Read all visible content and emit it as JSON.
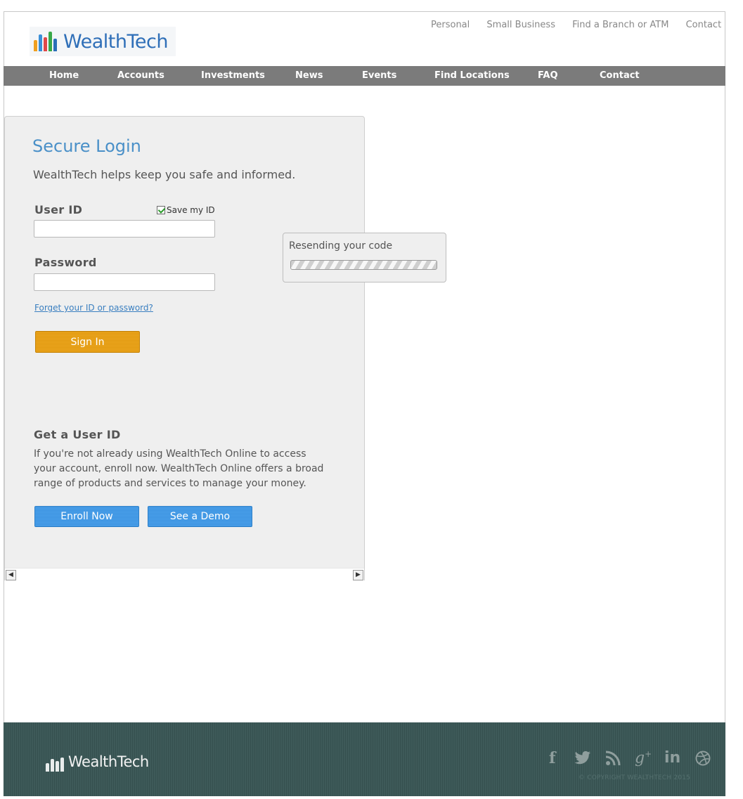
{
  "header": {
    "logo_text": "WealthTech",
    "top_links": [
      "Personal",
      "Small Business",
      "Find a Branch or ATM",
      "Contact Us"
    ]
  },
  "nav": {
    "items": [
      "Home",
      "Accounts",
      "Investments",
      "News",
      "Events",
      "Find Locations",
      "FAQ",
      "Contact"
    ]
  },
  "login": {
    "title": "Secure Login",
    "subtitle": "WealthTech helps keep you safe and informed.",
    "user_id_label": "User ID",
    "save_id_label": "Save my ID",
    "save_id_checked": true,
    "user_id_value": "",
    "password_label": "Password",
    "password_value": "",
    "forgot_link": "Forget your ID or password?",
    "sign_in_label": "Sign In"
  },
  "get_user_id": {
    "title": "Get a User ID",
    "text": "If you're not already using WealthTech Online to access your account, enroll now. WealthTech Online offers a broad range of products and services to manage your money.",
    "enroll_label": "Enroll Now",
    "demo_label": "See a Demo"
  },
  "popup": {
    "message": "Resending your code"
  },
  "footer": {
    "logo_text": "WealthTech",
    "social_icons": [
      "facebook-icon",
      "twitter-icon",
      "rss-icon",
      "google-plus-icon",
      "linkedin-icon",
      "dribbble-icon"
    ],
    "copyright": "© COPYRIGHT WEALTHTECH 2015"
  },
  "colors": {
    "nav_bg": "#7b7b7b",
    "title_blue": "#4a90c8",
    "sign_in_orange": "#e29a10",
    "button_blue": "#3d93e0",
    "footer_bg": "#3a5655"
  }
}
